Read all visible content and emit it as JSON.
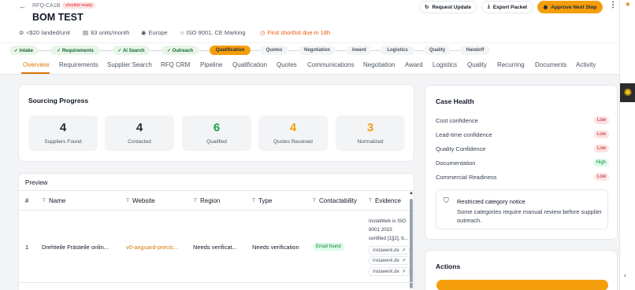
{
  "header": {
    "back_icon": "arrow-left-icon",
    "rfq_id": "RFQ-CA1B",
    "shortlist_badge": "shortlist ready",
    "title": "BOM TEST",
    "meta": {
      "price": "<$20 landed/unit",
      "volume": "83 units/month",
      "region": "Europe",
      "certs": "ISO 9001, CE Marking",
      "deadline": "First shortlist due in 18h"
    },
    "buttons": {
      "request_update": "Request Update",
      "export_packet": "Export Packet",
      "approve_next_step": "Approve Next Step"
    },
    "more": "⋮"
  },
  "pipeline": {
    "stages": [
      {
        "label": "✓ Intake",
        "state": "done"
      },
      {
        "label": "✓ Requirements",
        "state": "done"
      },
      {
        "label": "✓ AI Search",
        "state": "done"
      },
      {
        "label": "✓ Outreach",
        "state": "done"
      },
      {
        "label": "Qualification",
        "state": "active"
      },
      {
        "label": "Quotes",
        "state": "pending"
      },
      {
        "label": "Negotiation",
        "state": "pending"
      },
      {
        "label": "Award",
        "state": "pending"
      },
      {
        "label": "Logistics",
        "state": "pending"
      },
      {
        "label": "Quality",
        "state": "pending"
      },
      {
        "label": "Handoff",
        "state": "pending"
      }
    ]
  },
  "tabs": [
    "Overview",
    "Requirements",
    "Supplier Search",
    "RFQ CRM",
    "Pipeline",
    "Qualification",
    "Quotes",
    "Communications",
    "Negotiation",
    "Award",
    "Logistics",
    "Quality",
    "Recurring",
    "Documents",
    "Activity"
  ],
  "active_tab": "Overview",
  "progress": {
    "title": "Sourcing Progress",
    "stats": [
      {
        "value": "4",
        "label": "Suppliers Found",
        "color": "#111827"
      },
      {
        "value": "4",
        "label": "Contacted",
        "color": "#111827"
      },
      {
        "value": "6",
        "label": "Qualified",
        "color": "#16a34a"
      },
      {
        "value": "4",
        "label": "Quotes Received",
        "color": "#f59e0b"
      },
      {
        "value": "3",
        "label": "Normalized",
        "color": "#f59e0b"
      }
    ]
  },
  "preview": {
    "title": "Preview",
    "columns": [
      "#",
      "Name",
      "Website",
      "Region",
      "Type",
      "Contactability",
      "Evidence"
    ],
    "rows": [
      {
        "index": "1",
        "name": "Drehteile Frästeile onlin...",
        "website": "v0-axguard-precis...",
        "region": "Needs verificat...",
        "type": "Needs verification",
        "contactability": "Email found",
        "evidence_text": "InstaWerk is ISO 9001 2015 certified [1][2], b...",
        "evidence_links": [
          "instawerk.de",
          "instawerk.de",
          "instawerk.de"
        ]
      }
    ]
  },
  "case_health": {
    "title": "Case Health",
    "items": [
      {
        "label": "Cost confidence",
        "level": "Low"
      },
      {
        "label": "Lead-time confidence",
        "level": "Low"
      },
      {
        "label": "Quality Confidence",
        "level": "Low"
      },
      {
        "label": "Documentation",
        "level": "High"
      },
      {
        "label": "Commercial Readiness",
        "level": "Low"
      }
    ],
    "notice": {
      "title": "Restricted category notice",
      "body": "Some categories require manual review before supplier outreach."
    }
  },
  "actions": {
    "title": "Actions"
  },
  "colors": {
    "accent": "#f59e0b",
    "accent_text": "#d97706",
    "success": "#16a34a",
    "danger": "#dc2626"
  }
}
